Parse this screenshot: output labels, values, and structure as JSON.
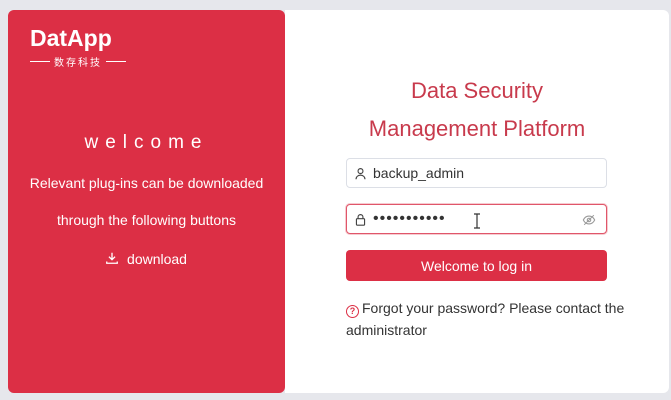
{
  "brand": {
    "logo_text": "DatApp",
    "logo_subtitle": "数存科技"
  },
  "left": {
    "welcome": "welcome",
    "desc_line1": "Relevant plug-ins can be downloaded",
    "desc_line2": "through the following buttons",
    "download_label": "download"
  },
  "right": {
    "title_line1": "Data Security",
    "title_line2": "Management Platform",
    "username_value": "backup_admin",
    "password_value": "•••••••••••",
    "login_label": "Welcome to log in",
    "help_text": "Forgot your password? Please contact the administrator"
  },
  "colors": {
    "brand_red": "#dc2f45",
    "title_red": "#c83a4c",
    "background": "#e6e7ec"
  },
  "icons": {
    "download": "download-icon",
    "user": "user-icon",
    "lock": "lock-icon",
    "eye": "eye-off-icon",
    "help": "question-circle-icon"
  }
}
